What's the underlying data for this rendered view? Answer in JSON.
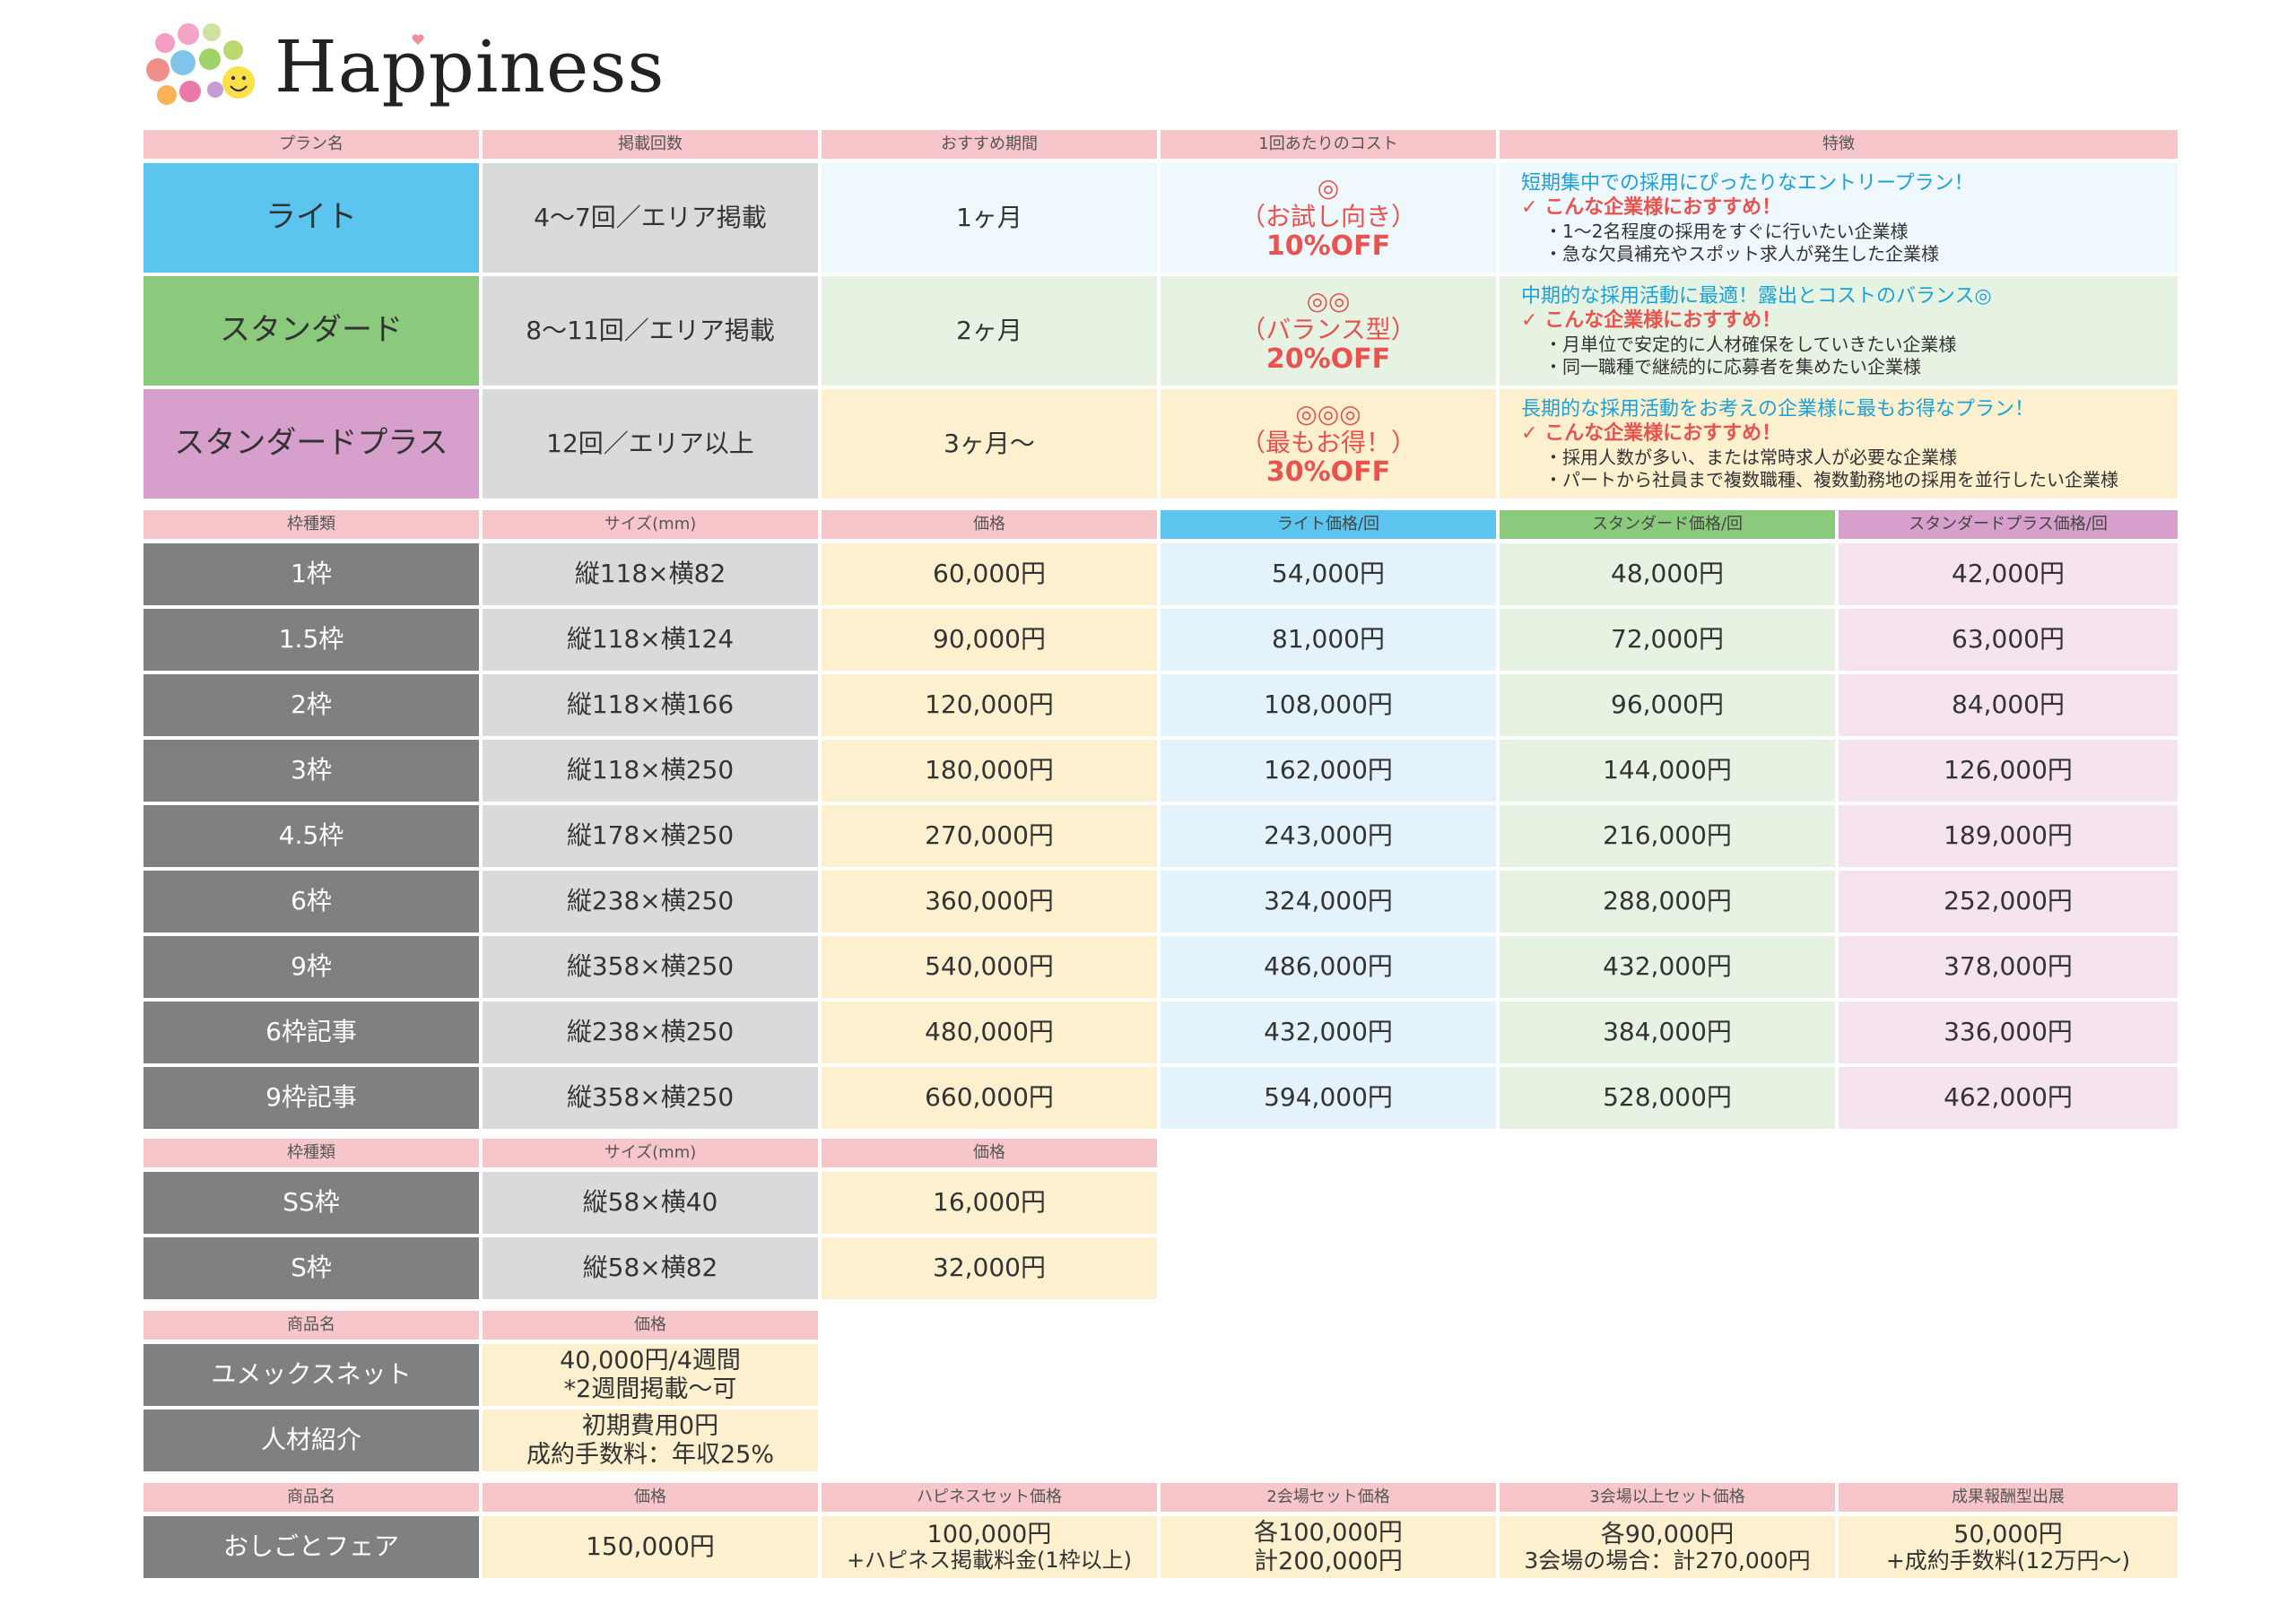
{
  "brand": {
    "name": "Happiness"
  },
  "plans": {
    "headers": [
      "プラン名",
      "掲載回数",
      "おすすめ期間",
      "1回あたりのコスト",
      "特徴"
    ],
    "rows": [
      {
        "name": "ライト",
        "count": "4〜7回／エリア掲載",
        "period": "1ヶ月",
        "mark": "◎",
        "cost_label": "（お試し向き）",
        "discount": "10%OFF",
        "headline": "短期集中での採用にぴったりなエントリープラン！",
        "recommend": "✓ こんな企業様におすすめ！",
        "points": [
          "・1〜2名程度の採用をすぐに行いたい企業様",
          "・急な欠員補充やスポット求人が発生した企業様"
        ]
      },
      {
        "name": "スタンダード",
        "count": "8〜11回／エリア掲載",
        "period": "2ヶ月",
        "mark": "◎◎",
        "cost_label": "（バランス型）",
        "discount": "20%OFF",
        "headline": "中期的な採用活動に最適！露出とコストのバランス◎",
        "recommend": "✓ こんな企業様におすすめ！",
        "points": [
          "・月単位で安定的に人材確保をしていきたい企業様",
          "・同一職種で継続的に応募者を集めたい企業様"
        ]
      },
      {
        "name": "スタンダードプラス",
        "count": "12回／エリア以上",
        "period": "3ヶ月〜",
        "mark": "◎◎◎",
        "cost_label": "（最もお得！）",
        "discount": "30%OFF",
        "headline": "長期的な採用活動をお考えの企業様に最もお得なプラン！",
        "recommend": "✓ こんな企業様におすすめ！",
        "points": [
          "・採用人数が多い、または常時求人が必要な企業様",
          "・パートから社員まで複数職種、複数勤務地の採用を並行したい企業様"
        ]
      }
    ]
  },
  "frames": {
    "headers": [
      "枠種類",
      "サイズ(mm)",
      "価格",
      "ライト価格/回",
      "スタンダード価格/回",
      "スタンダードプラス価格/回"
    ],
    "rows": [
      {
        "type": "1枠",
        "size": "縦118×横82",
        "price": "60,000円",
        "light": "54,000円",
        "standard": "48,000円",
        "plus": "42,000円"
      },
      {
        "type": "1.5枠",
        "size": "縦118×横124",
        "price": "90,000円",
        "light": "81,000円",
        "standard": "72,000円",
        "plus": "63,000円"
      },
      {
        "type": "2枠",
        "size": "縦118×横166",
        "price": "120,000円",
        "light": "108,000円",
        "standard": "96,000円",
        "plus": "84,000円"
      },
      {
        "type": "3枠",
        "size": "縦118×横250",
        "price": "180,000円",
        "light": "162,000円",
        "standard": "144,000円",
        "plus": "126,000円"
      },
      {
        "type": "4.5枠",
        "size": "縦178×横250",
        "price": "270,000円",
        "light": "243,000円",
        "standard": "216,000円",
        "plus": "189,000円"
      },
      {
        "type": "6枠",
        "size": "縦238×横250",
        "price": "360,000円",
        "light": "324,000円",
        "standard": "288,000円",
        "plus": "252,000円"
      },
      {
        "type": "9枠",
        "size": "縦358×横250",
        "price": "540,000円",
        "light": "486,000円",
        "standard": "432,000円",
        "plus": "378,000円"
      },
      {
        "type": "6枠記事",
        "size": "縦238×横250",
        "price": "480,000円",
        "light": "432,000円",
        "standard": "384,000円",
        "plus": "336,000円"
      },
      {
        "type": "9枠記事",
        "size": "縦358×横250",
        "price": "660,000円",
        "light": "594,000円",
        "standard": "528,000円",
        "plus": "462,000円"
      }
    ]
  },
  "small_frames": {
    "headers": [
      "枠種類",
      "サイズ(mm)",
      "価格"
    ],
    "rows": [
      {
        "type": "SS枠",
        "size": "縦58×横40",
        "price": "16,000円"
      },
      {
        "type": "S枠",
        "size": "縦58×横82",
        "price": "32,000円"
      }
    ]
  },
  "products": {
    "headers": [
      "商品名",
      "価格"
    ],
    "rows": [
      {
        "name": "ユメックスネット",
        "price_line1": "40,000円/4週間",
        "price_line2": "*2週間掲載〜可"
      },
      {
        "name": "人材紹介",
        "price_line1": "初期費用0円",
        "price_line2": "成約手数料：年収25%"
      }
    ]
  },
  "fair": {
    "headers": [
      "商品名",
      "価格",
      "ハピネスセット価格",
      "2会場セット価格",
      "3会場以上セット価格",
      "成果報酬型出展"
    ],
    "name": "おしごとフェア",
    "price": "150,000円",
    "happiness_line1": "100,000円",
    "happiness_line2": "+ハピネス掲載料金(1枠以上)",
    "two_line1": "各100,000円",
    "two_line2": "計200,000円",
    "three_line1": "各90,000円",
    "three_line2": "3会場の場合：計270,000円",
    "reward_line1": "50,000円",
    "reward_line2": "+成約手数料(12万円〜)"
  },
  "colors": {
    "header_pink": "#f7c6cb",
    "light_blue": "#5bc5ef",
    "standard_green": "#8bc97c",
    "plus_purple": "#d79fcb",
    "discount_red": "#e8524f",
    "headline_blue": "#1ba1d8"
  }
}
